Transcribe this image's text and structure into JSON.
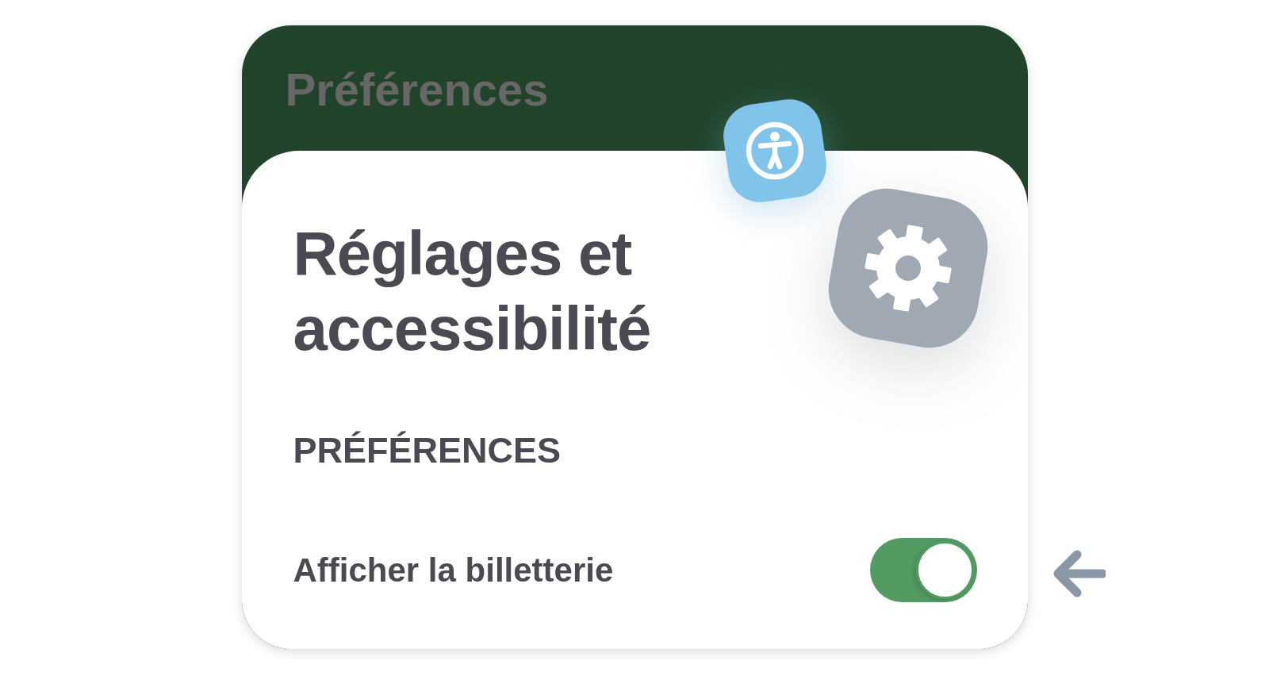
{
  "header": {
    "title": "Préférences"
  },
  "page": {
    "title": "Réglages et accessibilité",
    "section": "PRÉFÉRENCES",
    "settings": [
      {
        "label": "Afficher la billetterie",
        "on": true
      }
    ]
  }
}
